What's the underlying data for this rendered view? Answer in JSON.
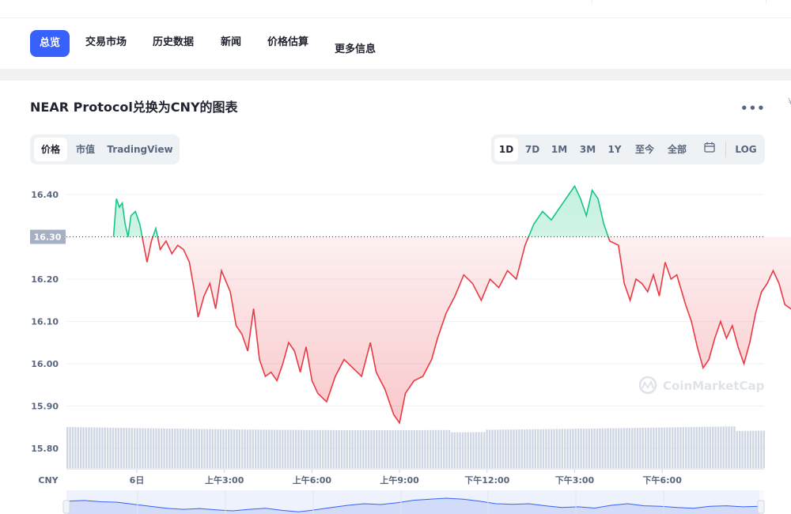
{
  "nav": {
    "tabs": [
      {
        "label": "总览",
        "active": true
      },
      {
        "label": "交易市场",
        "active": false
      },
      {
        "label": "历史数据",
        "active": false
      },
      {
        "label": "新闻",
        "active": false
      },
      {
        "label": "价格估算",
        "active": false
      },
      {
        "label": "更多信息",
        "active": false
      }
    ]
  },
  "header": {
    "title": "NEAR Protocol兑换为CNY的图表",
    "more_icon": "more-horizontal-icon"
  },
  "chart_tabs": [
    "价格",
    "市值",
    "TradingView"
  ],
  "range_tabs": [
    "1D",
    "7D",
    "1M",
    "3M",
    "1Y",
    "至今",
    "全部"
  ],
  "range_active": "1D",
  "log_label": "LOG",
  "watermark": "CoinMarketCap",
  "colors": {
    "accent": "#3861fb",
    "up": "#16c784",
    "down": "#ea3943",
    "volume": "#cfd6e4"
  },
  "chart_data": {
    "type": "line",
    "currency_label": "CNY",
    "reference_price": 16.3,
    "reference_label": "16.30",
    "ylim": [
      15.75,
      16.45
    ],
    "y_ticks": [
      15.8,
      15.9,
      16.0,
      16.1,
      16.2,
      16.3,
      16.4
    ],
    "y_tick_labels": [
      "15.80",
      "15.90",
      "16.00",
      "16.10",
      "16.20",
      "16.30",
      "16.40"
    ],
    "x_range": [
      -0.8,
      23.0
    ],
    "x_ticks": [
      {
        "t": 0,
        "label": "6日"
      },
      {
        "t": 3,
        "label": "上午3:00"
      },
      {
        "t": 6,
        "label": "上午6:00"
      },
      {
        "t": 9,
        "label": "上午9:00"
      },
      {
        "t": 12,
        "label": "下午12:00"
      },
      {
        "t": 15,
        "label": "下午3:00"
      },
      {
        "t": 18,
        "label": "下午6:00"
      }
    ],
    "series": [
      {
        "values": [
          [
            -0.8,
            16.3
          ],
          [
            -0.7,
            16.39
          ],
          [
            -0.6,
            16.37
          ],
          [
            -0.5,
            16.38
          ],
          [
            -0.4,
            16.33
          ],
          [
            -0.3,
            16.3
          ],
          [
            -0.2,
            16.35
          ],
          [
            -0.05,
            16.36
          ],
          [
            0.1,
            16.33
          ],
          [
            0.35,
            16.24
          ],
          [
            0.5,
            16.29
          ],
          [
            0.65,
            16.32
          ],
          [
            0.8,
            16.27
          ],
          [
            1.0,
            16.29
          ],
          [
            1.2,
            16.26
          ],
          [
            1.4,
            16.28
          ],
          [
            1.6,
            16.27
          ],
          [
            1.8,
            16.24
          ],
          [
            1.95,
            16.18
          ],
          [
            2.1,
            16.11
          ],
          [
            2.3,
            16.16
          ],
          [
            2.5,
            16.19
          ],
          [
            2.7,
            16.13
          ],
          [
            2.9,
            16.22
          ],
          [
            3.2,
            16.17
          ],
          [
            3.4,
            16.09
          ],
          [
            3.6,
            16.07
          ],
          [
            3.8,
            16.03
          ],
          [
            4.0,
            16.13
          ],
          [
            4.2,
            16.01
          ],
          [
            4.4,
            15.97
          ],
          [
            4.6,
            15.98
          ],
          [
            4.8,
            15.96
          ],
          [
            5.0,
            16.0
          ],
          [
            5.2,
            16.05
          ],
          [
            5.4,
            16.03
          ],
          [
            5.6,
            15.98
          ],
          [
            5.8,
            16.04
          ],
          [
            6.0,
            15.96
          ],
          [
            6.2,
            15.93
          ],
          [
            6.5,
            15.91
          ],
          [
            6.8,
            15.97
          ],
          [
            7.1,
            16.01
          ],
          [
            7.4,
            15.99
          ],
          [
            7.7,
            15.97
          ],
          [
            8.0,
            16.05
          ],
          [
            8.2,
            15.98
          ],
          [
            8.5,
            15.94
          ],
          [
            8.8,
            15.88
          ],
          [
            9.0,
            15.86
          ],
          [
            9.2,
            15.93
          ],
          [
            9.5,
            15.96
          ],
          [
            9.8,
            15.97
          ],
          [
            10.1,
            16.01
          ],
          [
            10.3,
            16.06
          ],
          [
            10.6,
            16.12
          ],
          [
            10.9,
            16.16
          ],
          [
            11.2,
            16.21
          ],
          [
            11.5,
            16.19
          ],
          [
            11.8,
            16.15
          ],
          [
            12.1,
            16.2
          ],
          [
            12.4,
            16.18
          ],
          [
            12.7,
            16.22
          ],
          [
            13.0,
            16.2
          ],
          [
            13.3,
            16.28
          ],
          [
            13.6,
            16.33
          ],
          [
            13.9,
            16.36
          ],
          [
            14.2,
            16.34
          ],
          [
            14.5,
            16.37
          ],
          [
            14.8,
            16.4
          ],
          [
            15.0,
            16.42
          ],
          [
            15.2,
            16.39
          ],
          [
            15.4,
            16.35
          ],
          [
            15.6,
            16.41
          ],
          [
            15.8,
            16.39
          ],
          [
            16.0,
            16.33
          ],
          [
            16.2,
            16.29
          ],
          [
            16.5,
            16.28
          ],
          [
            16.7,
            16.19
          ],
          [
            16.9,
            16.15
          ],
          [
            17.1,
            16.2
          ],
          [
            17.3,
            16.19
          ],
          [
            17.5,
            16.17
          ],
          [
            17.7,
            16.21
          ],
          [
            17.9,
            16.16
          ],
          [
            18.1,
            16.24
          ],
          [
            18.3,
            16.2
          ],
          [
            18.5,
            16.21
          ],
          [
            18.8,
            16.14
          ],
          [
            19.0,
            16.1
          ],
          [
            19.2,
            16.04
          ],
          [
            19.4,
            15.99
          ],
          [
            19.6,
            16.01
          ],
          [
            19.8,
            16.06
          ],
          [
            20.0,
            16.1
          ],
          [
            20.2,
            16.06
          ],
          [
            20.4,
            16.09
          ],
          [
            20.6,
            16.04
          ],
          [
            20.8,
            16.0
          ],
          [
            21.0,
            16.05
          ],
          [
            21.2,
            16.12
          ],
          [
            21.4,
            16.17
          ],
          [
            21.6,
            16.19
          ],
          [
            21.8,
            16.22
          ],
          [
            22.0,
            16.19
          ],
          [
            22.2,
            16.14
          ],
          [
            22.4,
            16.13
          ],
          [
            22.6,
            16.12
          ],
          [
            22.8,
            16.08
          ],
          [
            23.0,
            16.11
          ]
        ]
      }
    ],
    "navigator_values": [
      16.3,
      16.33,
      16.28,
      16.26,
      16.18,
      16.1,
      16.02,
      15.98,
      16.01,
      15.96,
      15.92,
      15.98,
      16.02,
      15.94,
      15.88,
      15.96,
      16.05,
      16.14,
      16.2,
      16.17,
      16.24,
      16.34,
      16.38,
      16.42,
      16.38,
      16.3,
      16.2,
      16.18,
      16.2,
      16.12,
      16.05,
      16.08,
      16.03,
      16.14,
      16.2,
      16.12,
      16.1,
      16.05,
      16.02,
      16.1,
      16.12,
      16.08,
      16.1
    ]
  }
}
